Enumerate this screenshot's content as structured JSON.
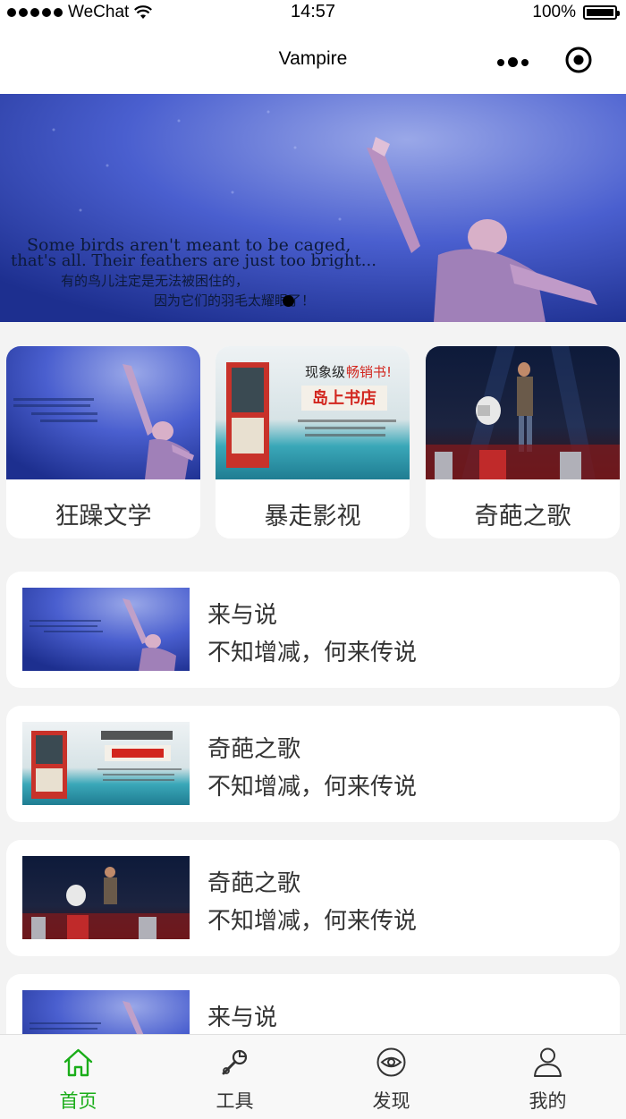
{
  "status_bar": {
    "carrier": "WeChat",
    "time": "14:57",
    "battery": "100%"
  },
  "navbar": {
    "title": "Vampire",
    "more_icon": "more-dots-icon",
    "close_icon": "target-icon"
  },
  "banner": {
    "line1": "Some birds aren't meant to be caged,",
    "line2": "that's all. Their feathers are just too bright...",
    "line3": "有的鸟儿注定是无法被困住的，",
    "line4": "因为它们的羽毛太耀眼了！"
  },
  "categories": [
    {
      "label": "狂躁文学",
      "thumb": "shawshank-poster"
    },
    {
      "label": "暴走影视",
      "thumb": "book-island-poster"
    },
    {
      "label": "奇葩之歌",
      "thumb": "stage-concert"
    }
  ],
  "book_poster": {
    "headline_a": "现象级",
    "headline_b": "畅销书!",
    "title": "岛上书店"
  },
  "list": [
    {
      "title": "来与说",
      "desc": "不知增减，何来传说",
      "thumb": "shawshank-poster"
    },
    {
      "title": "奇葩之歌",
      "desc": "不知增减，何来传说",
      "thumb": "book-island-poster"
    },
    {
      "title": "奇葩之歌",
      "desc": "不知增减，何来传说",
      "thumb": "stage-concert"
    },
    {
      "title": "来与说",
      "desc": "",
      "thumb": "shawshank-poster"
    }
  ],
  "tabbar": [
    {
      "label": "首页",
      "icon": "home-icon",
      "active": true
    },
    {
      "label": "工具",
      "icon": "wrench-icon",
      "active": false
    },
    {
      "label": "发现",
      "icon": "eye-icon",
      "active": false
    },
    {
      "label": "我的",
      "icon": "user-icon",
      "active": false
    }
  ],
  "colors": {
    "active_tab": "#1aad19",
    "banner_blue": "#2f4bb5"
  }
}
